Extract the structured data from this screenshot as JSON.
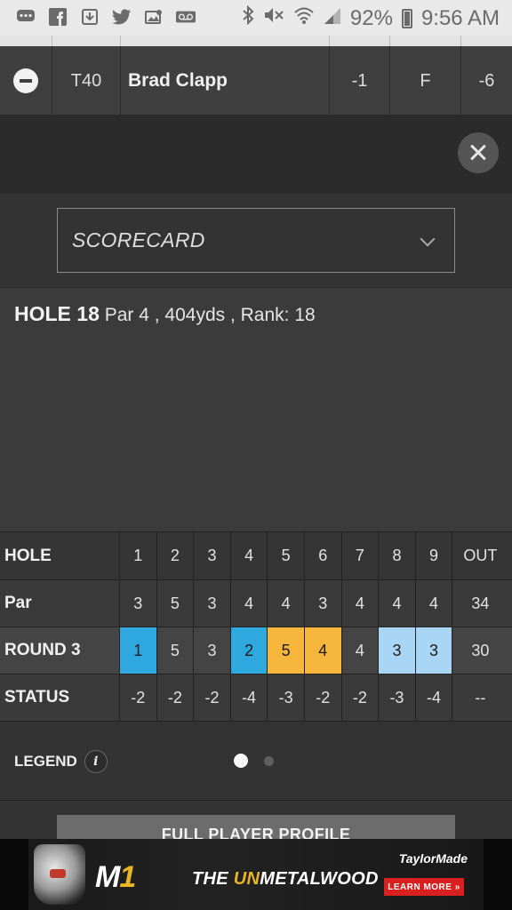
{
  "status_bar": {
    "battery": "92%",
    "time": "9:56 AM",
    "left_icons": [
      "message-icon",
      "facebook-icon",
      "download-icon",
      "twitter-icon",
      "photo-icon",
      "voicemail-icon"
    ],
    "right_icons": [
      "bluetooth-icon",
      "mute-icon",
      "wifi-icon",
      "signal-icon",
      "battery-icon"
    ]
  },
  "player": {
    "position": "T40",
    "name": "Brad Clapp",
    "today": "-1",
    "thru": "F",
    "total": "-6"
  },
  "dropdown": {
    "selected": "SCORECARD"
  },
  "hole_info": {
    "hole": "HOLE 18",
    "details": "Par 4 , 404yds , Rank: 18"
  },
  "scorecard": {
    "labels": {
      "hole": "HOLE",
      "par": "Par",
      "round": "ROUND 3",
      "status": "STATUS"
    },
    "holes": [
      "1",
      "2",
      "3",
      "4",
      "5",
      "6",
      "7",
      "8",
      "9",
      "OUT"
    ],
    "par": [
      "3",
      "5",
      "3",
      "4",
      "4",
      "3",
      "4",
      "4",
      "4",
      "34"
    ],
    "round": [
      "1",
      "5",
      "3",
      "2",
      "5",
      "4",
      "4",
      "3",
      "3",
      "30"
    ],
    "status": [
      "-2",
      "-2",
      "-2",
      "-4",
      "-3",
      "-2",
      "-2",
      "-3",
      "-4",
      "--"
    ],
    "colors": {
      "eagle": "#2fa7df",
      "bogey": "#f6b63c",
      "birdie": "#a9d6f5"
    }
  },
  "legend": {
    "label": "LEGEND",
    "pages": 2,
    "active_page": 1
  },
  "profile_button": "FULL PLAYER PROFILE",
  "ad": {
    "logo_m": "M",
    "logo_1": "1",
    "tag_pre": "THE ",
    "tag_hl": "UN",
    "tag_post": "METALWOOD",
    "brand": "TaylorMade",
    "cta": "LEARN MORE »"
  }
}
